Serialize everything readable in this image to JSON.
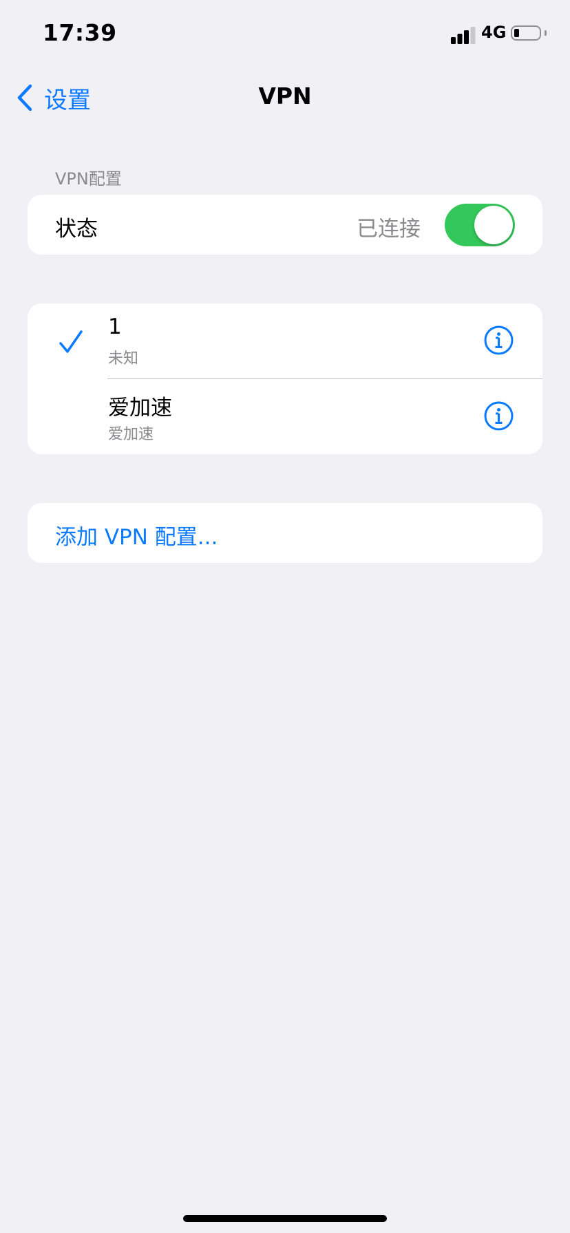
{
  "status_bar": {
    "time": "17:39",
    "network": "4G",
    "battery_level": 0.22
  },
  "nav": {
    "back_label": "设置",
    "title": "VPN"
  },
  "vpn_config": {
    "section_header": "VPN配置",
    "status_label": "状态",
    "status_value": "已连接",
    "toggle_on": true
  },
  "vpn_list": [
    {
      "name": "1",
      "subtitle": "未知",
      "selected": true
    },
    {
      "name": "爱加速",
      "subtitle": "爱加速",
      "selected": false
    }
  ],
  "add_label": "添加 VPN 配置...",
  "colors": {
    "accent": "#0a7aff",
    "toggle_on": "#34c759",
    "background": "#f0f0f5",
    "secondary_text": "#8a8a8e"
  }
}
